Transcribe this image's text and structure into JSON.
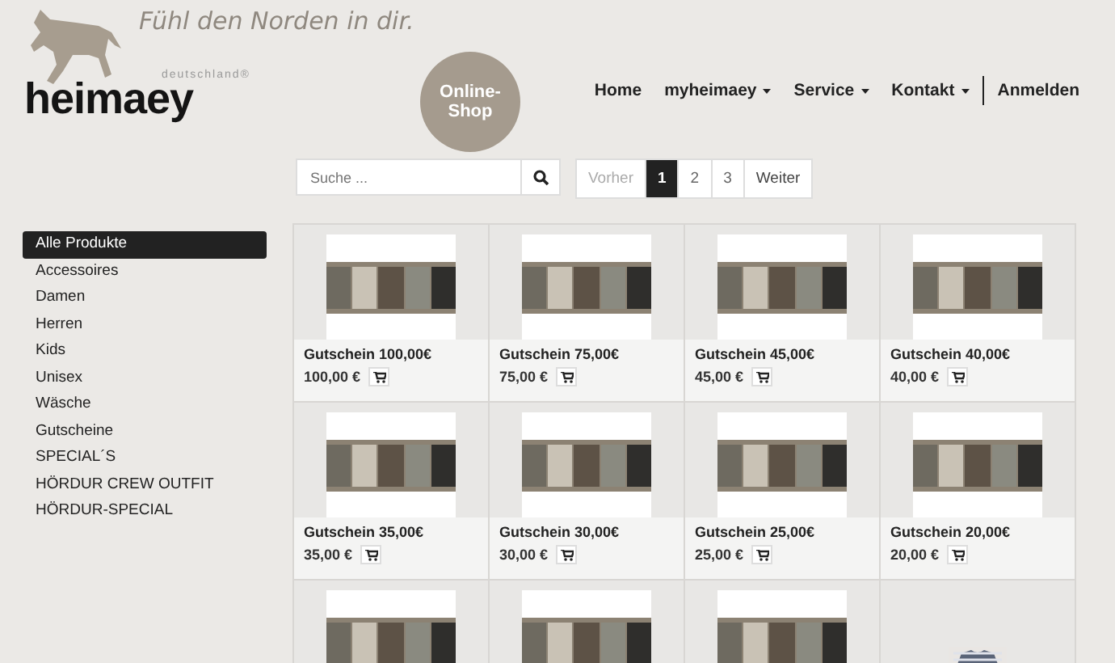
{
  "header": {
    "tagline": "Fühl den Norden in dir.",
    "logo_sub": "deutschland®",
    "logo_name": "heimaey",
    "badge": "Online-Shop"
  },
  "nav": [
    {
      "label": "Home",
      "dropdown": false
    },
    {
      "label": "myheimaey",
      "dropdown": true
    },
    {
      "label": "Service",
      "dropdown": true
    },
    {
      "label": "Kontakt",
      "dropdown": true
    },
    {
      "label": "Anmelden",
      "dropdown": false
    }
  ],
  "search": {
    "placeholder": "Suche ..."
  },
  "pagination": [
    {
      "label": "Vorher",
      "selected": false
    },
    {
      "label": "1",
      "selected": true
    },
    {
      "label": "2",
      "selected": false
    },
    {
      "label": "3",
      "selected": false
    },
    {
      "label": "Weiter",
      "selected": false
    }
  ],
  "sidebar": {
    "items": [
      {
        "label": "Alle Produkte",
        "selected": true
      },
      {
        "label": "Accessoires",
        "selected": false
      },
      {
        "label": "Damen",
        "selected": false
      },
      {
        "label": "Herren",
        "selected": false
      },
      {
        "label": "Kids",
        "selected": false
      },
      {
        "label": "Unisex",
        "selected": false
      },
      {
        "label": "Wäsche",
        "selected": false
      },
      {
        "label": "Gutscheine",
        "selected": false
      },
      {
        "label": "SPECIAL´S",
        "selected": false
      },
      {
        "label": "HÖRDUR CREW OUTFIT",
        "selected": false
      },
      {
        "label": "HÖRDUR-SPECIAL",
        "selected": false
      }
    ]
  },
  "products": [
    {
      "kind": "voucher",
      "name": "Gutschein 100,00€",
      "price": "100,00 €"
    },
    {
      "kind": "voucher",
      "name": "Gutschein 75,00€",
      "price": "75,00 €"
    },
    {
      "kind": "voucher",
      "name": "Gutschein 45,00€",
      "price": "45,00 €"
    },
    {
      "kind": "voucher",
      "name": "Gutschein 40,00€",
      "price": "40,00 €"
    },
    {
      "kind": "voucher",
      "name": "Gutschein 35,00€",
      "price": "35,00 €"
    },
    {
      "kind": "voucher",
      "name": "Gutschein 30,00€",
      "price": "30,00 €"
    },
    {
      "kind": "voucher",
      "name": "Gutschein 25,00€",
      "price": "25,00 €"
    },
    {
      "kind": "voucher",
      "name": "Gutschein 20,00€",
      "price": "20,00 €"
    },
    {
      "kind": "voucher"
    },
    {
      "kind": "voucher"
    },
    {
      "kind": "voucher"
    },
    {
      "kind": "shirt"
    }
  ]
}
